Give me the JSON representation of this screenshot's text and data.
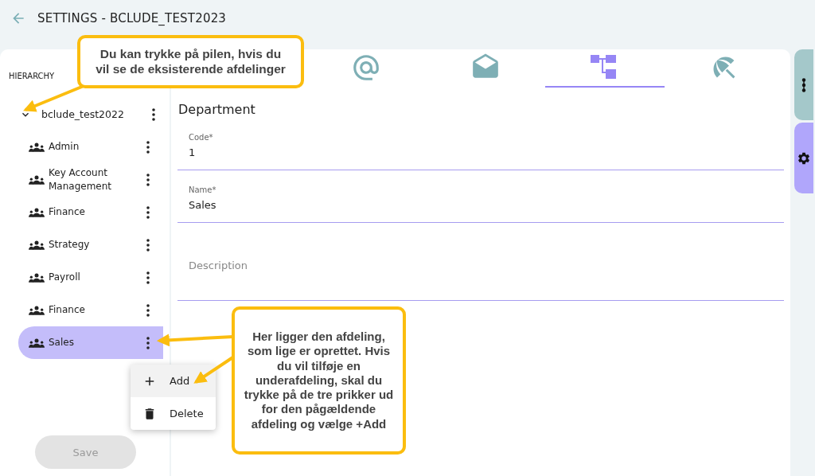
{
  "header": {
    "title": "SETTINGS - BCLUDE_TEST2023"
  },
  "sidebar": {
    "heading": "HIERARCHY",
    "root": {
      "label": "bclude_test2022",
      "expanded": true,
      "children": [
        {
          "label": "Admin",
          "selected": false
        },
        {
          "label": "Key Account Management",
          "selected": false
        },
        {
          "label": "Finance",
          "selected": false
        },
        {
          "label": "Strategy",
          "selected": false
        },
        {
          "label": "Payroll",
          "selected": false
        },
        {
          "label": "Finance",
          "selected": false
        },
        {
          "label": "Sales",
          "selected": true
        }
      ]
    },
    "save_button": {
      "label": "Save",
      "disabled": true
    }
  },
  "tabs": [
    {
      "kind": "email",
      "selected": false
    },
    {
      "kind": "mail",
      "selected": false
    },
    {
      "kind": "hierarchy",
      "selected": true
    },
    {
      "kind": "umbrella",
      "selected": false
    }
  ],
  "form": {
    "title": "Department",
    "fields": [
      {
        "label": "Code*",
        "value": "1"
      },
      {
        "label": "Name*",
        "value": "Sales"
      },
      {
        "placeholder": "Description"
      }
    ]
  },
  "context_menu": {
    "items": [
      {
        "kind": "add",
        "label": "Add",
        "selected": true
      },
      {
        "kind": "delete",
        "label": "Delete",
        "selected": false
      }
    ]
  },
  "side_tabs": [
    {
      "kind": "dots",
      "selected": false
    },
    {
      "kind": "settings",
      "selected": true
    }
  ],
  "callouts": [
    {
      "text": "Du kan trykke på pilen, hvis du vil se de eksisterende afdelinger"
    },
    {
      "text": "Her ligger den afdeling, som lige er oprettet. Hvis du vil tilføje en underafdeling, skal du trykke på de tre prikker ud for den pågældende afdeling og vælge +Add"
    }
  ]
}
